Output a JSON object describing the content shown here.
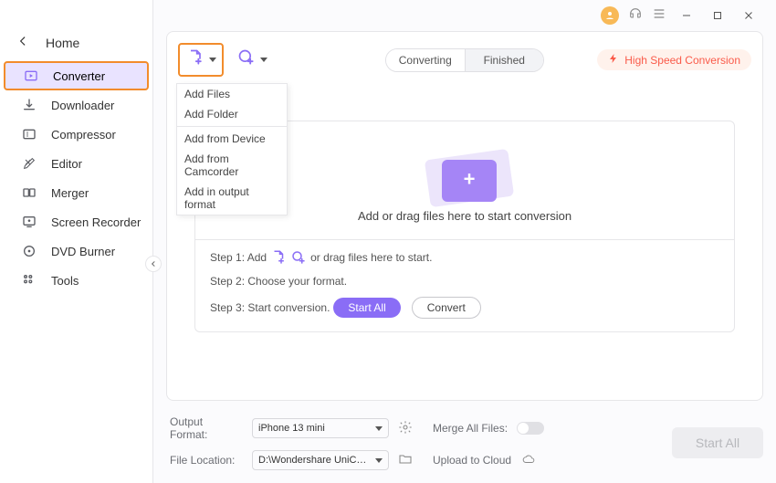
{
  "sidebar": {
    "home_label": "Home",
    "items": [
      {
        "label": "Converter"
      },
      {
        "label": "Downloader"
      },
      {
        "label": "Compressor"
      },
      {
        "label": "Editor"
      },
      {
        "label": "Merger"
      },
      {
        "label": "Screen Recorder"
      },
      {
        "label": "DVD Burner"
      },
      {
        "label": "Tools"
      }
    ]
  },
  "tabs": {
    "converting": "Converting",
    "finished": "Finished"
  },
  "hsc_label": "High Speed Conversion",
  "add_menu": {
    "add_files": "Add Files",
    "add_folder": "Add Folder",
    "add_device": "Add from Device",
    "add_camcorder": "Add from Camcorder",
    "add_output_format": "Add in output format"
  },
  "drop_text": "Add or drag files here to start conversion",
  "steps": {
    "s1_prefix": "Step 1: Add",
    "s1_suffix": "or drag files here to start.",
    "s2": "Step 2: Choose your format.",
    "s3": "Step 3: Start conversion.",
    "start_all": "Start All",
    "convert": "Convert"
  },
  "footer": {
    "output_format_label": "Output Format:",
    "output_format_value": "iPhone 13 mini",
    "merge_label": "Merge All Files:",
    "file_location_label": "File Location:",
    "file_location_value": "D:\\Wondershare UniConverter 1",
    "upload_cloud_label": "Upload to Cloud",
    "start_all_label": "Start All"
  }
}
